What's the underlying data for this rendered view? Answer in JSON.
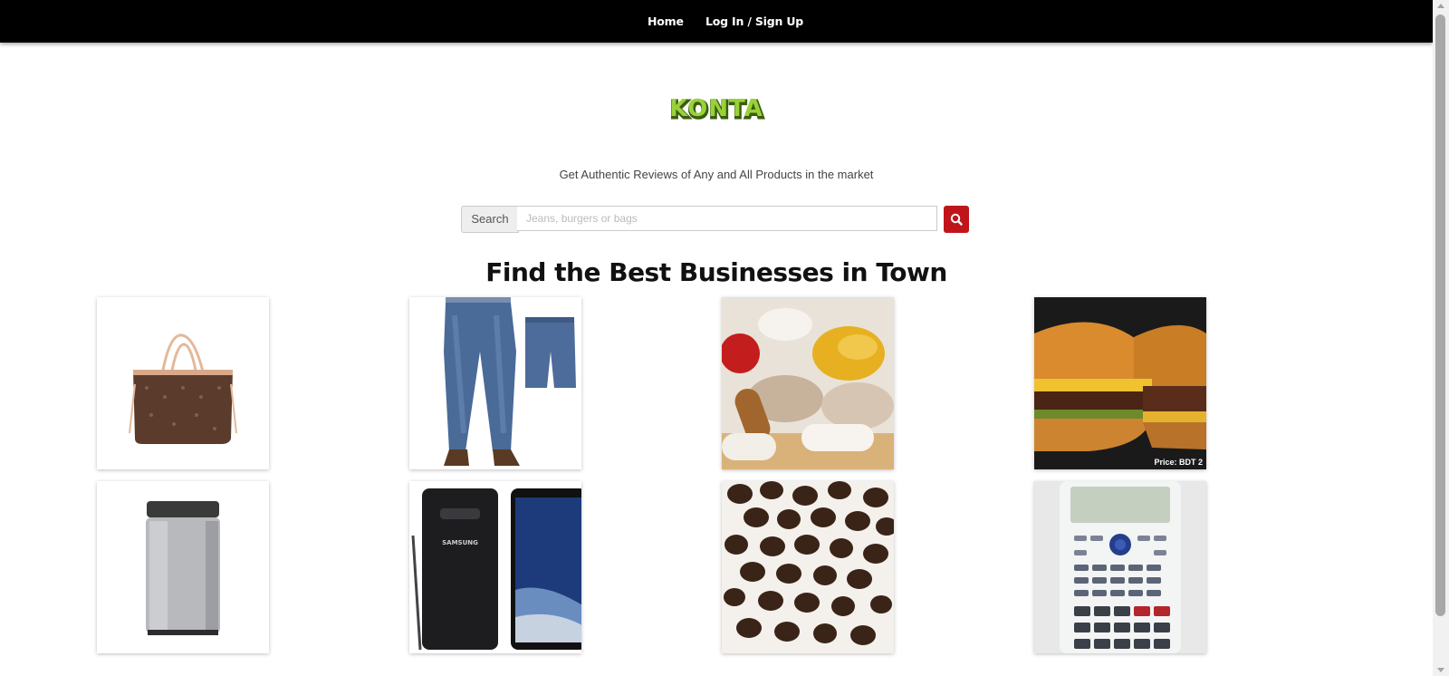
{
  "nav": {
    "home_label": "Home",
    "login_label": "Log In / Sign Up"
  },
  "logo": {
    "text": "KONTA"
  },
  "tagline": "Get Authentic Reviews of Any and All Products in the market",
  "search": {
    "addon_label": "Search",
    "placeholder": "Jeans, burgers or bags",
    "button_icon": "search-icon"
  },
  "heading": "Find the Best Businesses in Town",
  "products": [
    {
      "name": "handbag",
      "icon": "handbag-image"
    },
    {
      "name": "jeans",
      "icon": "jeans-image"
    },
    {
      "name": "supplements",
      "icon": "pills-image"
    },
    {
      "name": "burgers",
      "icon": "burger-image",
      "price_text": "Price: BDT 2"
    },
    {
      "name": "washing-machine",
      "icon": "washer-image"
    },
    {
      "name": "smartphone",
      "icon": "phone-image",
      "brand_text": "SAMSUNG"
    },
    {
      "name": "chocolate-chips",
      "icon": "chocolate-image"
    },
    {
      "name": "calculator",
      "icon": "calculator-image"
    }
  ],
  "colors": {
    "navbar": "#000000",
    "search_button": "#c0141b",
    "logo_green": "#8cc63f"
  }
}
